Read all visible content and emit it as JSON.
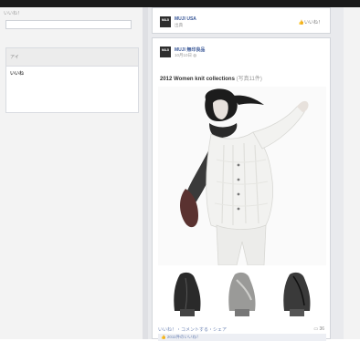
{
  "left_sidebar": {
    "top_label": "いいね！",
    "panel_header": "アイ",
    "panel_item": "いいね"
  },
  "top_post": {
    "logo_text": "MUJI",
    "page_name": "MUJI USA",
    "subtitle": "出典",
    "like_label": "いいね！"
  },
  "main_post": {
    "logo_text": "MUJI",
    "page_name": "MUJI 無印良品",
    "timestamp": "10月10日",
    "title": "2012 Women knit collections",
    "photo_count": "(写真11件)",
    "actions": "いいね！・コメントする・シェア",
    "comment_count": "36",
    "likes_line": "2011件のいいね！"
  },
  "colors": {
    "link": "#3b5998",
    "page_bg": "#e9eaed",
    "card_bg": "#ffffff"
  }
}
